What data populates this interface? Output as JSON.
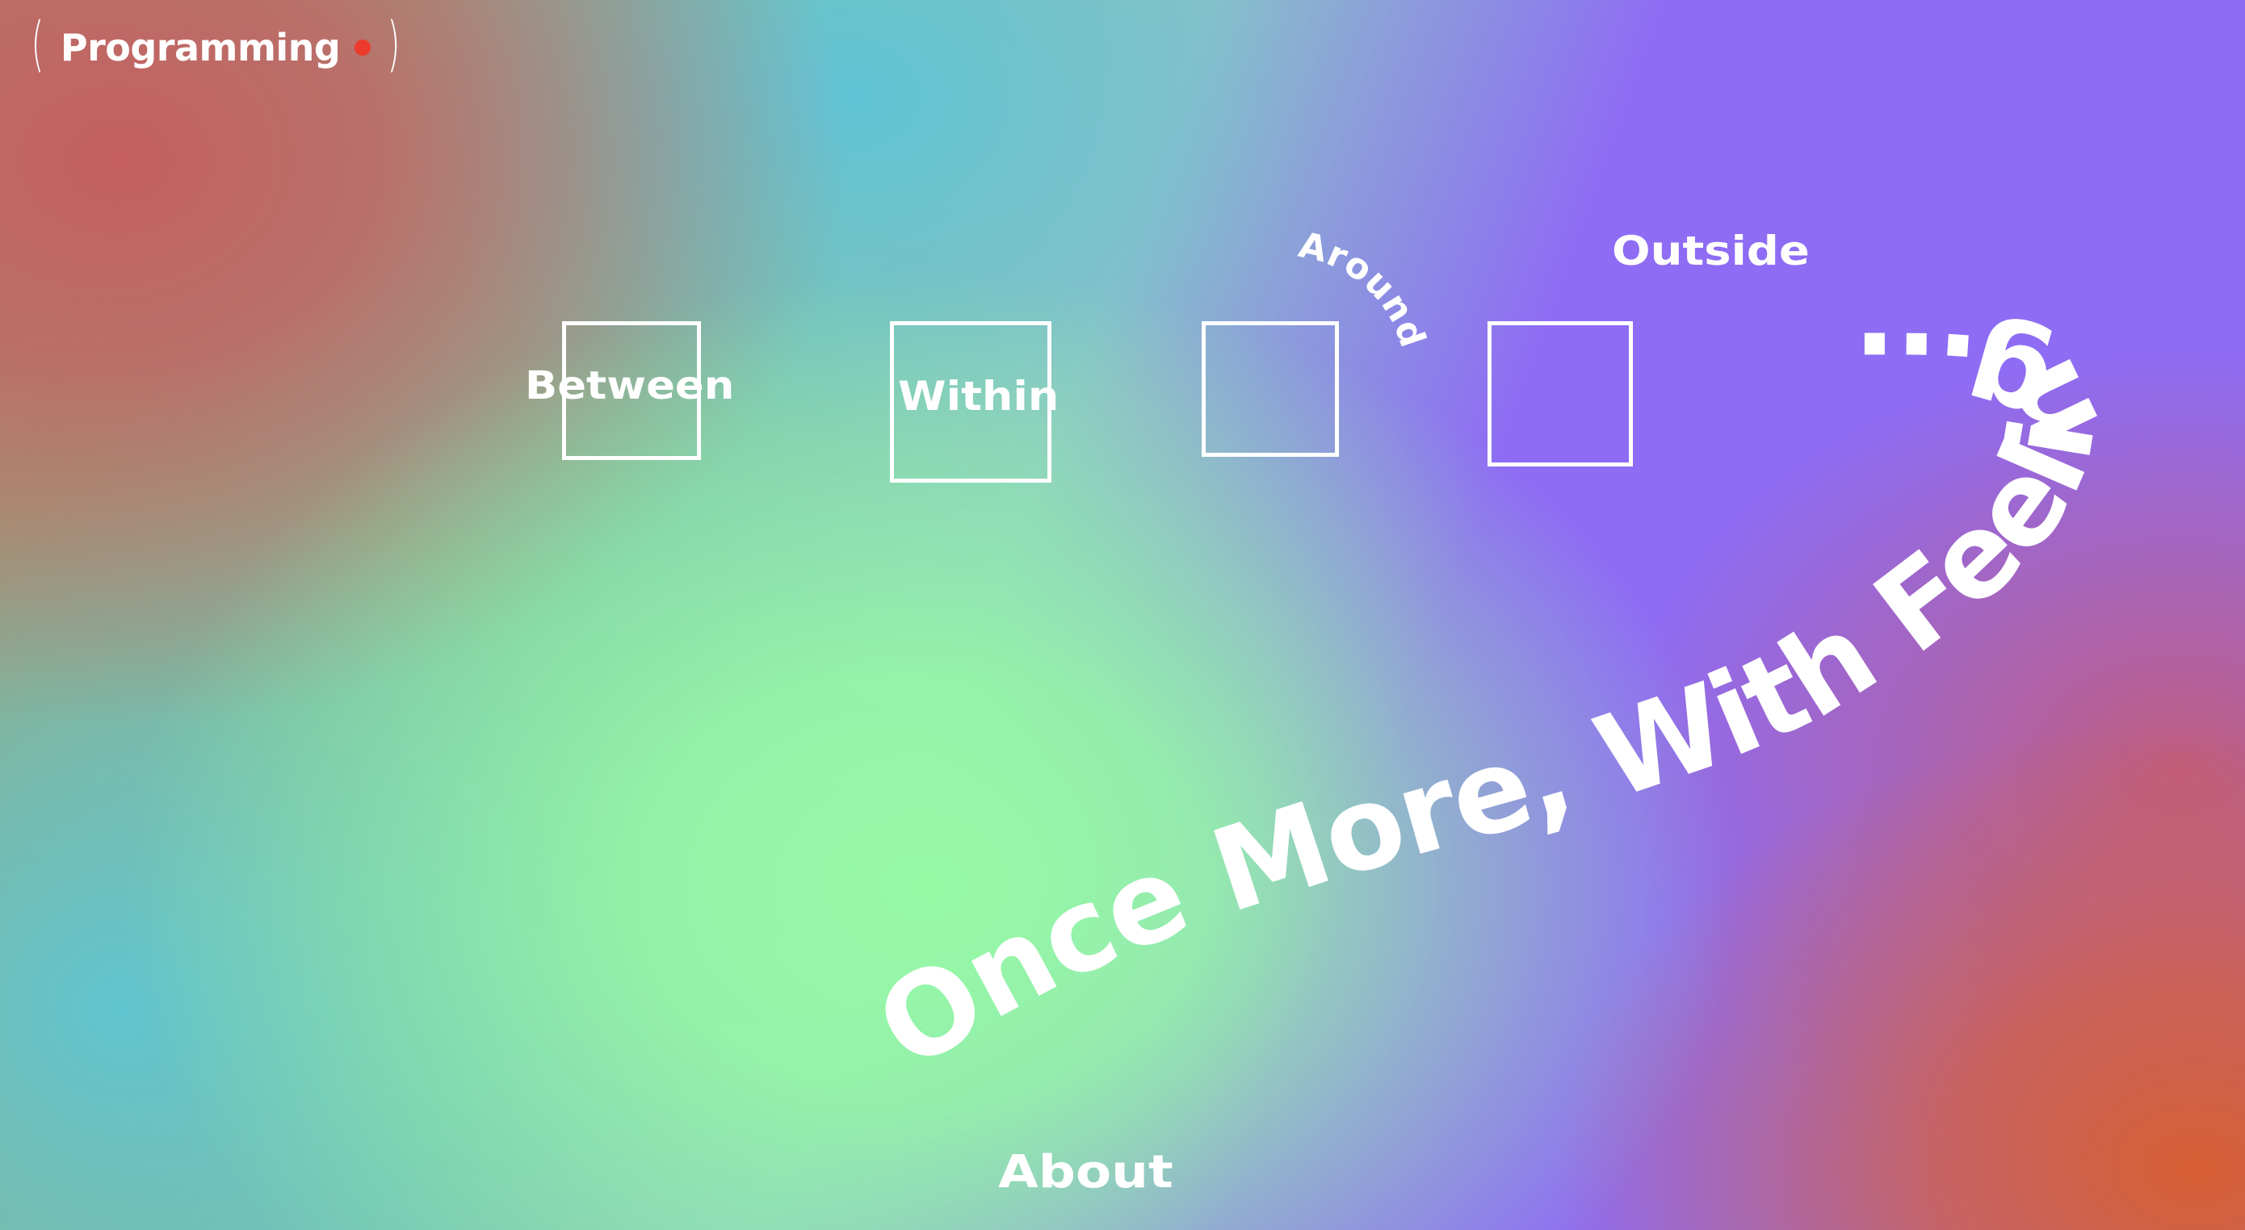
{
  "header": {
    "badge_label": "Programming",
    "live_indicator_color": "#ec3a2c"
  },
  "nav": {
    "between": "Between",
    "within": "Within",
    "around": "Around",
    "outside": "Outside",
    "about": "About"
  },
  "headline": "Once More, With Feeling...",
  "colors": {
    "text": "#ffffff",
    "purple": "#8e6cf4",
    "green": "#96faa5",
    "red": "#c46062",
    "orange": "#d86034",
    "teal": "#62c4ce"
  }
}
